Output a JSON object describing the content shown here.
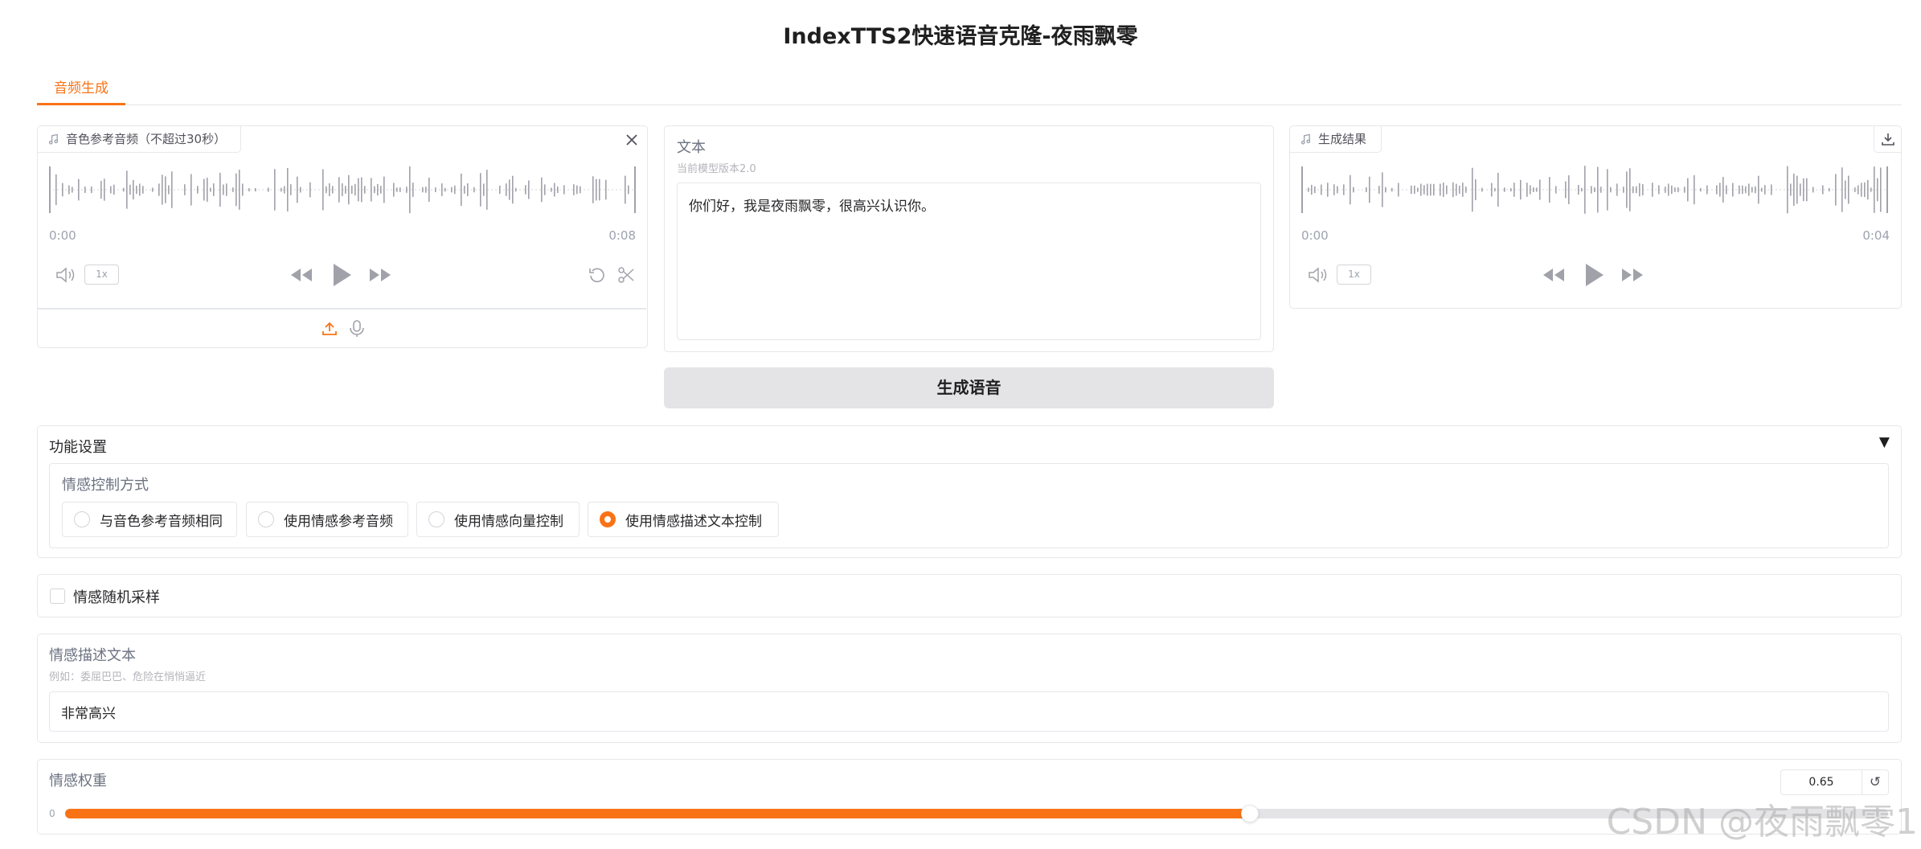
{
  "app_title": "IndexTTS2快速语音克隆-夜雨飘零",
  "tabs": [
    {
      "label": "音频生成",
      "active": true
    }
  ],
  "reference_audio": {
    "label": "音色参考音频（不超过30秒）",
    "time_start": "0:00",
    "time_end": "0:08",
    "playback_rate": "1x"
  },
  "text_panel": {
    "label": "文本",
    "info": "当前模型版本2.0",
    "value": "你们好，我是夜雨飘零，很高兴认识你。"
  },
  "result_audio": {
    "label": "生成结果",
    "time_start": "0:00",
    "time_end": "0:04",
    "playback_rate": "1x"
  },
  "generate_button": "生成语音",
  "settings": {
    "title": "功能设置",
    "toggle_glyph": "▼",
    "emotion_mode": {
      "label": "情感控制方式",
      "options": [
        "与音色参考音频相同",
        "使用情感参考音频",
        "使用情感向量控制",
        "使用情感描述文本控制"
      ],
      "selected": "使用情感描述文本控制"
    }
  },
  "random_sampling": {
    "label": "情感随机采样",
    "checked": false
  },
  "emotion_text": {
    "label": "情感描述文本",
    "info": "例如：委屈巴巴、危险在悄悄逼近",
    "value": "非常高兴"
  },
  "emotion_weight": {
    "label": "情感权重",
    "value": "0.65",
    "min_label": "0",
    "fraction": 0.65,
    "reset_glyph": "↺"
  },
  "watermark": "CSDN @夜雨飘零1",
  "colors": {
    "accent": "#f97316",
    "border": "#e5e7eb",
    "muted": "#9ca3af"
  }
}
